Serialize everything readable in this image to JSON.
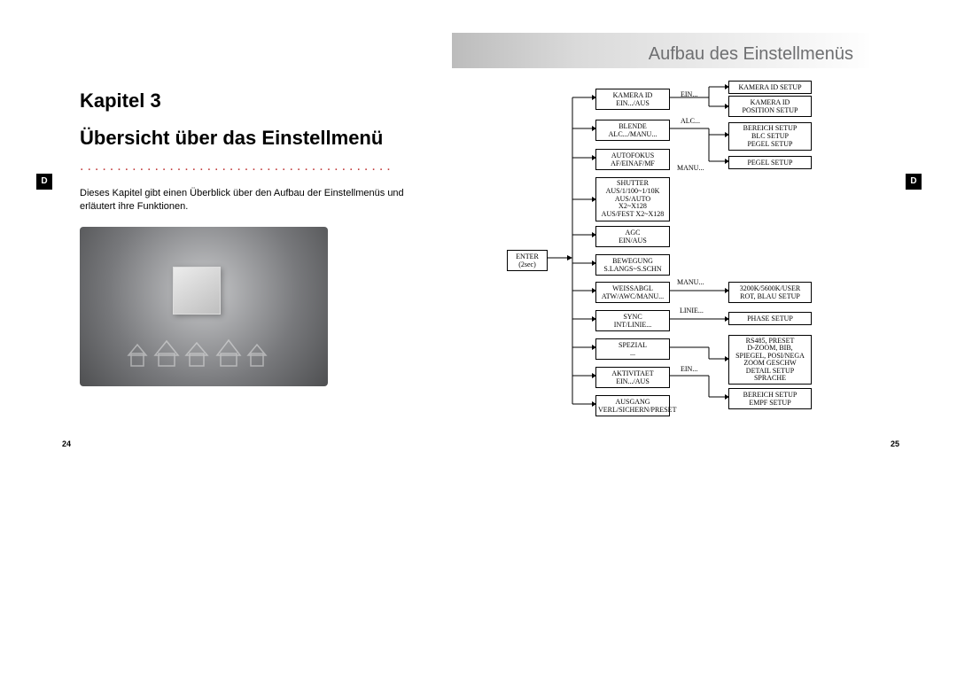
{
  "side_tab": "D",
  "banner_title": "Aufbau des Einstellmenüs",
  "chapter_line1": "Kapitel 3",
  "chapter_line2": "Übersicht über das Einstellmenü",
  "intro_text": "Dieses Kapitel gibt einen Überblick über den Aufbau der Einstellmenüs und erläutert ihre Funktionen.",
  "dots": "..........................................",
  "page_left": "24",
  "page_right": "25",
  "enter": {
    "l1": "ENTER",
    "l2": "(2sec)"
  },
  "col2": {
    "kamera_id": "KAMERA ID\nEIN.../AUS",
    "blende": "BLENDE\nALC.../MANU...",
    "autofokus": "AUTOFOKUS\nAF/EINAF/MF",
    "shutter": "SHUTTER\nAUS/1/100~1/10K\nAUS/AUTO\nX2~X128\nAUS/FEST X2~X128",
    "agc": "AGC\nEIN/AUS",
    "bewegung": "BEWEGUNG\nS.LANGS~S.SCHN",
    "weissabgl": "WEISSABGL\nATW/AWC/MANU...",
    "sync": "SYNC\nINT/LINIE...",
    "spezial": "SPEZIAL\n...",
    "aktivitaet": "AKTIVITAET\nEIN.../AUS",
    "ausgang": "AUSGANG\nVERL/SICHERN/PRESET"
  },
  "col3": {
    "kamera_id_setup": "KAMERA ID SETUP",
    "kamera_id_pos": "KAMERA ID\nPOSITION SETUP",
    "bereich": "BEREICH SETUP\nBLC SETUP\nPEGEL SETUP",
    "pegel": "PEGEL SETUP",
    "wb": "3200K/5600K/USER\nROT, BLAU SETUP",
    "phase": "PHASE SETUP",
    "spezial_sub": "RS485, PRESET\nD-ZOOM, BIB,\nSPIEGEL, POSI/NEGA\nZOOM GESCHW\nDETAIL SETUP\nSPRACHE",
    "akt_sub": "BEREICH SETUP\nEMPF SETUP"
  },
  "edge": {
    "ein": "EIN...",
    "alc": "ALC...",
    "manu_iris": "MANU...",
    "manu_wb": "MANU...",
    "linie": "LINIE...",
    "ein_akt": "EIN..."
  }
}
